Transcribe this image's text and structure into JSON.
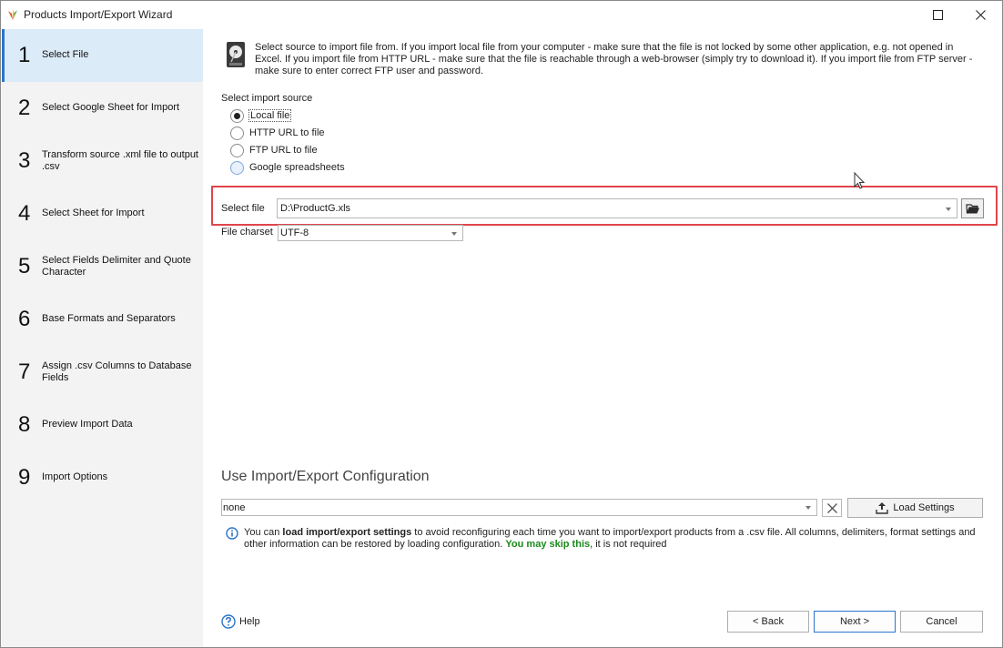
{
  "window": {
    "title": "Products Import/Export Wizard"
  },
  "steps": [
    {
      "num": "1",
      "label": "Select File",
      "active": true
    },
    {
      "num": "2",
      "label": "Select Google Sheet for Import"
    },
    {
      "num": "3",
      "label": "Transform source .xml file to output .csv"
    },
    {
      "num": "4",
      "label": "Select Sheet for Import"
    },
    {
      "num": "5",
      "label": "Select Fields Delimiter and Quote Character"
    },
    {
      "num": "6",
      "label": "Base Formats and Separators"
    },
    {
      "num": "7",
      "label": "Assign .csv Columns to Database Fields"
    },
    {
      "num": "8",
      "label": "Preview Import Data"
    },
    {
      "num": "9",
      "label": "Import Options"
    }
  ],
  "main": {
    "intro": "Select source to import file from. If you import local file from your computer - make sure that the file is not locked by some other application, e.g. not opened in Excel. If you import file from HTTP URL - make sure that the file is reachable through a web-browser (simply try to download it). If you import file from FTP server - make sure to enter correct FTP user and password.",
    "source_label": "Select import source",
    "sources": [
      {
        "label": "Local file",
        "checked": true
      },
      {
        "label": "HTTP URL to file",
        "checked": false
      },
      {
        "label": "FTP URL to file",
        "checked": false
      },
      {
        "label": "Google spreadsheets",
        "checked": false
      }
    ],
    "select_file_label": "Select file",
    "select_file_value": "D:\\ProductG.xls",
    "charset_label": "File charset",
    "charset_value": "UTF-8",
    "config_title": "Use Import/Export Configuration",
    "config_value": "none",
    "load_settings_label": "Load Settings",
    "info": {
      "part1": "You can ",
      "bold": "load import/export settings",
      "part2": " to avoid reconfiguring each time you want to import/export products from a .csv file. All columns, delimiters, format settings and other information can be restored by loading configuration. ",
      "green": "You may skip this",
      "part3": ", it is not required"
    },
    "help_label": "Help",
    "back_label": "< Back",
    "next_label": "Next >",
    "cancel_label": "Cancel"
  },
  "colors": {
    "highlight": "#e0454c",
    "active_step_bg": "#dcebf8",
    "accent": "#2c74c8",
    "green_text": "#1c8a1c"
  }
}
